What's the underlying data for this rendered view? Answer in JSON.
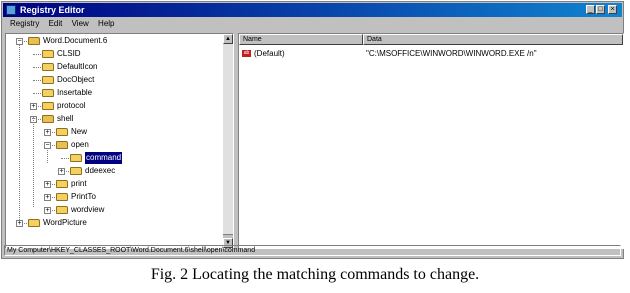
{
  "window": {
    "title": "Registry Editor",
    "controls": [
      "_",
      "□",
      "×"
    ]
  },
  "menu": [
    "Registry",
    "Edit",
    "View",
    "Help"
  ],
  "tree": {
    "nodes": [
      {
        "label": "Word.Document.6",
        "level": 0,
        "toggle": "−",
        "open": true
      },
      {
        "label": "CLSID",
        "level": 1,
        "toggle": ""
      },
      {
        "label": "DefaultIcon",
        "level": 1,
        "toggle": ""
      },
      {
        "label": "DocObject",
        "level": 1,
        "toggle": ""
      },
      {
        "label": "Insertable",
        "level": 1,
        "toggle": ""
      },
      {
        "label": "protocol",
        "level": 1,
        "toggle": "+"
      },
      {
        "label": "shell",
        "level": 1,
        "toggle": "−",
        "open": true
      },
      {
        "label": "New",
        "level": 2,
        "toggle": "+"
      },
      {
        "label": "open",
        "level": 2,
        "toggle": "−",
        "open": true
      },
      {
        "label": "command",
        "level": 3,
        "toggle": "",
        "selected": true
      },
      {
        "label": "ddeexec",
        "level": 3,
        "toggle": "+"
      },
      {
        "label": "print",
        "level": 2,
        "toggle": "+"
      },
      {
        "label": "PrintTo",
        "level": 2,
        "toggle": "+"
      },
      {
        "label": "wordview",
        "level": 2,
        "toggle": "+"
      },
      {
        "label": "WordPicture",
        "level": 0,
        "toggle": "+"
      }
    ]
  },
  "list": {
    "columns": [
      "Name",
      "Data"
    ],
    "rows": [
      {
        "icon": "ab",
        "name": "(Default)",
        "data": "\"C:\\MSOFFICE\\WINWORD\\WINWORD.EXE /n\""
      }
    ]
  },
  "status": "My Computer\\HKEY_CLASSES_ROOT\\Word.Document.6\\shell\\open\\command",
  "caption": "Fig. 2 Locating the matching commands to change."
}
